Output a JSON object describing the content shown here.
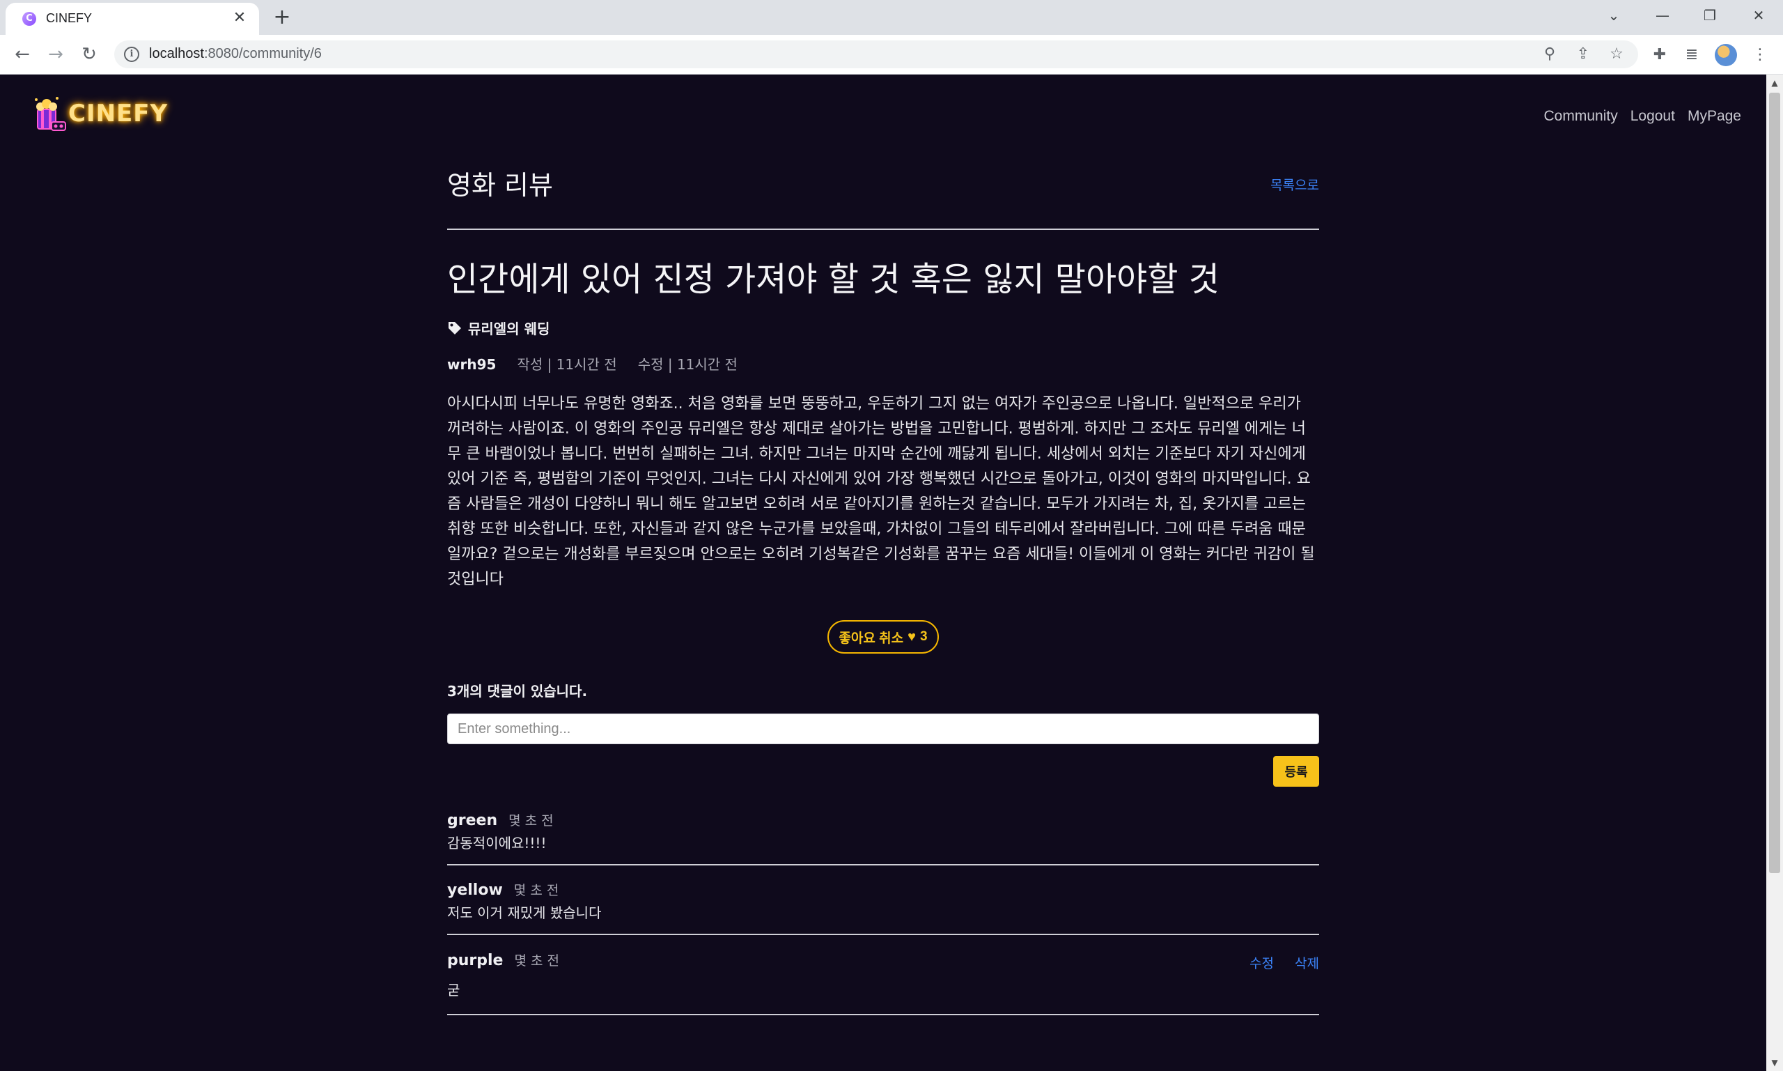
{
  "browser": {
    "tab_title": "CINEFY",
    "url_host": "localhost",
    "url_path": ":8080/community/6"
  },
  "header": {
    "logo_text": "CINEFY",
    "nav": [
      "Community",
      "Logout",
      "MyPage"
    ]
  },
  "board": {
    "title": "영화 리뷰",
    "back_link": "목록으로"
  },
  "post": {
    "title": "인간에게 있어 진정 가져야 할 것 혹은 잃지 말아야할 것",
    "movie_tag": "뮤리엘의 웨딩",
    "author": "wrh95",
    "created": "작성 | 11시간 전",
    "updated": "수정 | 11시간 전",
    "content": "아시다시피 너무나도 유명한 영화죠.. 처음 영화를 보면 뚱뚱하고, 우둔하기 그지 없는 여자가 주인공으로 나옵니다. 일반적으로 우리가 꺼려하는 사람이죠. 이 영화의 주인공 뮤리엘은 항상 제대로 살아가는 방법을 고민합니다. 평범하게. 하지만 그 조차도 뮤리엘 에게는 너무 큰 바램이었나 봅니다. 번번히 실패하는 그녀. 하지만 그녀는 마지막 순간에 깨닳게 됩니다. 세상에서 외치는 기준보다 자기 자신에게 있어 기준 즉, 평범함의 기준이 무엇인지. 그녀는 다시 자신에게 있어 가장 행복했던 시간으로 돌아가고, 이것이 영화의 마지막입니다. 요즘 사람들은 개성이 다양하니 뭐니 해도 알고보면 오히려 서로 같아지기를 원하는것 같습니다. 모두가 가지려는 차, 집, 옷가지를 고르는 취향 또한 비슷합니다. 또한, 자신들과 같지 않은 누군가를 보았을때, 가차없이 그들의 테두리에서 잘라버립니다. 그에 따른 두려움 때문일까요? 겉으로는 개성화를 부르짖으며 안으로는 오히려 기성복같은 기성화를 꿈꾸는 요즘 세대들! 이들에게 이 영화는 커다란 귀감이 될 것입니다",
    "like_label": "좋아요 취소",
    "like_count": "3"
  },
  "comments_section": {
    "count_text": "3개의 댓글이 있습니다.",
    "input_placeholder": "Enter something...",
    "submit_label": "등록",
    "items": [
      {
        "author": "green",
        "time": "몇 초 전",
        "body": "감동적이에요!!!!"
      },
      {
        "author": "yellow",
        "time": "몇 초 전",
        "body": "저도 이거 재밌게 봤습니다"
      },
      {
        "author": "purple",
        "time": "몇 초 전",
        "body": "굳",
        "edit_label": "수정",
        "delete_label": "삭제"
      }
    ]
  }
}
